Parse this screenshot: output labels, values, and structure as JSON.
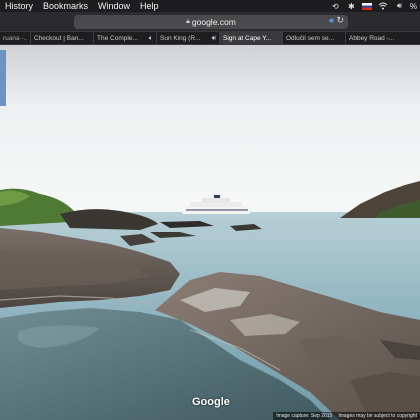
{
  "menubar": {
    "items": [
      "History",
      "Bookmarks",
      "Window",
      "Help"
    ],
    "tray": {
      "battery": "%"
    }
  },
  "toolbar": {
    "address": "google.com"
  },
  "tabs": [
    {
      "title": "ruana -...",
      "sound": false,
      "active": false
    },
    {
      "title": "Checkout | Ban...",
      "sound": false,
      "active": false
    },
    {
      "title": "The Comple...",
      "sound": true,
      "active": false
    },
    {
      "title": "Sun King (R...",
      "sound": true,
      "active": false
    },
    {
      "title": "Sign at Cape Y...",
      "sound": false,
      "active": true
    },
    {
      "title": "Odlučil sem se...",
      "sound": false,
      "active": false
    },
    {
      "title": "Abbey Road -...",
      "sound": false,
      "active": false
    }
  ],
  "map": {
    "logo": "Google",
    "footer": {
      "capture": "Image capture: Sep 2015",
      "copyright": "Images may be subject to copyright"
    }
  }
}
